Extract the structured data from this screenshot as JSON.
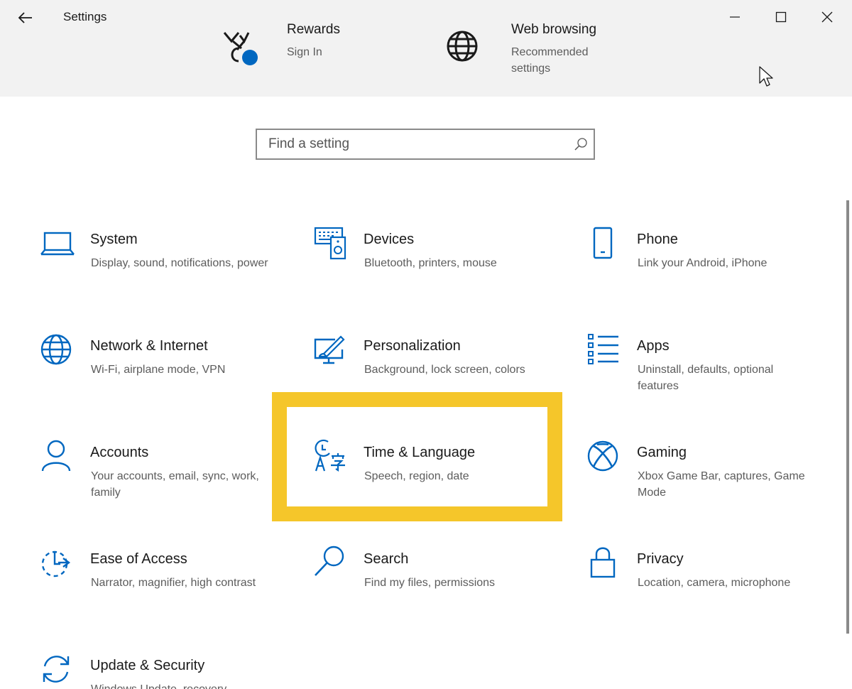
{
  "window": {
    "title": "Settings",
    "controls": [
      "minimize",
      "maximize",
      "close"
    ]
  },
  "banner": [
    {
      "title": "Rewards",
      "subtitle": "Sign In",
      "icon": "rewards-icon"
    },
    {
      "title": "Web browsing",
      "subtitle": "Recommended settings",
      "icon": "globe-icon"
    }
  ],
  "search": {
    "placeholder": "Find a setting",
    "value": ""
  },
  "tiles": [
    {
      "title": "System",
      "desc": "Display, sound, notifications, power",
      "icon": "laptop-icon"
    },
    {
      "title": "Devices",
      "desc": "Bluetooth, printers, mouse",
      "icon": "devices-icon"
    },
    {
      "title": "Phone",
      "desc": "Link your Android, iPhone",
      "icon": "phone-icon"
    },
    {
      "title": "Network & Internet",
      "desc": "Wi-Fi, airplane mode, VPN",
      "icon": "globe-icon"
    },
    {
      "title": "Personalization",
      "desc": "Background, lock screen, colors",
      "icon": "personalization-icon"
    },
    {
      "title": "Apps",
      "desc": "Uninstall, defaults, optional features",
      "icon": "apps-list-icon"
    },
    {
      "title": "Accounts",
      "desc": "Your accounts, email, sync, work, family",
      "icon": "person-icon"
    },
    {
      "title": "Time & Language",
      "desc": "Speech, region, date",
      "icon": "time-language-icon"
    },
    {
      "title": "Gaming",
      "desc": "Xbox Game Bar, captures, Game Mode",
      "icon": "xbox-icon"
    },
    {
      "title": "Ease of Access",
      "desc": "Narrator, magnifier, high contrast",
      "icon": "ease-of-access-icon"
    },
    {
      "title": "Search",
      "desc": "Find my files, permissions",
      "icon": "search-icon"
    },
    {
      "title": "Privacy",
      "desc": "Location, camera, microphone",
      "icon": "lock-icon"
    },
    {
      "title": "Update & Security",
      "desc": "Windows Update, recovery,",
      "icon": "update-sync-icon"
    }
  ],
  "colors": {
    "accent": "#0067c0",
    "highlight": "#f5c62a",
    "banner_bg": "#f2f2f2"
  }
}
